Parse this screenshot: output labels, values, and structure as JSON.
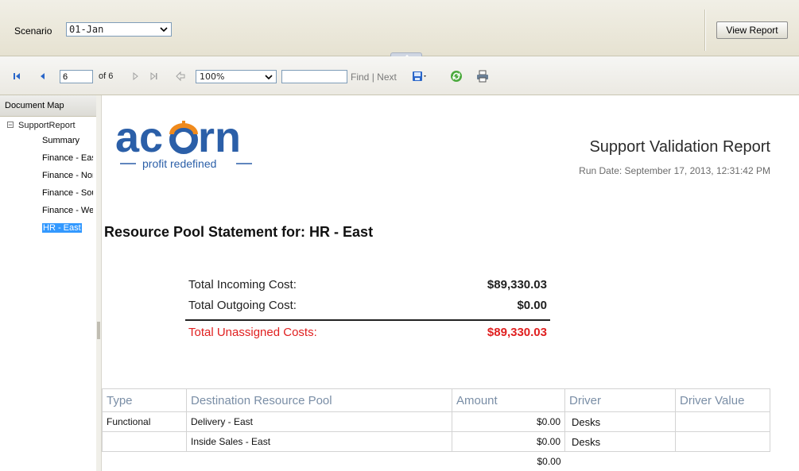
{
  "parameters": {
    "scenario_label": "Scenario",
    "scenario_value": "01-Jan",
    "view_report_label": "View Report"
  },
  "toolbar": {
    "page_value": "6",
    "page_of": "of 6",
    "zoom_value": "100%",
    "find_label": "Find",
    "separator": "|",
    "next_label": "Next",
    "icons": [
      "first-page-icon",
      "previous-page-icon",
      "next-page-icon",
      "last-page-icon",
      "back-icon",
      "export-icon",
      "refresh-icon",
      "print-icon"
    ]
  },
  "document_map": {
    "header": "Document Map",
    "root": "SupportReport",
    "root_toggle": "−",
    "items": [
      {
        "label": "Summary"
      },
      {
        "label": "Finance - East"
      },
      {
        "label": "Finance - North"
      },
      {
        "label": "Finance - South"
      },
      {
        "label": "Finance - West"
      },
      {
        "label": "HR - East",
        "selected": true
      }
    ]
  },
  "report": {
    "logo": {
      "wordmark": "acorn",
      "tagline": "profit redefined"
    },
    "title": "Support Validation Report",
    "run_date": "Run Date: September 17, 2013, 12:31:42 PM",
    "statement_heading": "Resource Pool Statement for: HR - East",
    "costs": [
      {
        "label": "Total Incoming Cost:",
        "value": "$89,330.03"
      },
      {
        "label": "Total Outgoing Cost:",
        "value": "$0.00"
      },
      {
        "label": "Total Unassigned Costs:",
        "value": "$89,330.03",
        "highlight_color": "#e02020"
      }
    ],
    "table": {
      "headers": [
        "Type",
        "Destination Resource Pool",
        "Amount",
        "Driver",
        "Driver Value"
      ],
      "rows": [
        {
          "type": "Functional",
          "pool": "Delivery - East",
          "amount": "$0.00",
          "driver": "Desks",
          "driver_value": ""
        },
        {
          "type": "",
          "pool": "Inside Sales - East",
          "amount": "$0.00",
          "driver": "Desks",
          "driver_value": ""
        }
      ],
      "total_amount": "$0.00"
    }
  },
  "colors": {
    "accent_blue": "#2b5fa8",
    "logo_orange": "#f08a1c",
    "selection": "#3399ff",
    "negative_red": "#e02020"
  }
}
